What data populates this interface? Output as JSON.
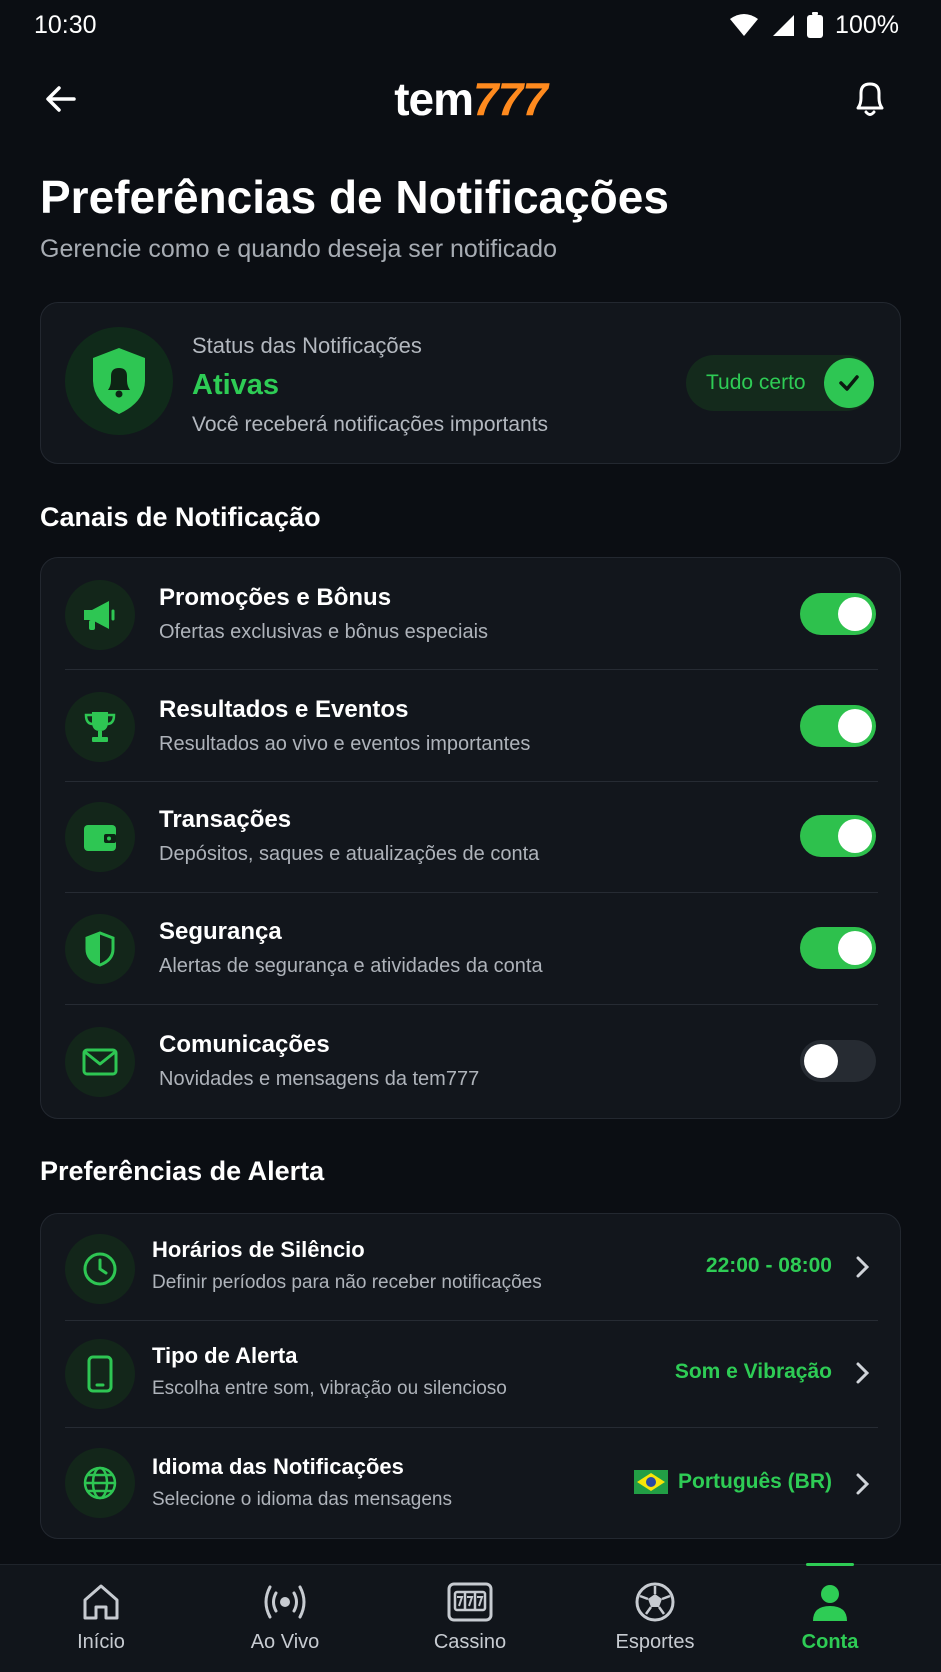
{
  "status_bar": {
    "time": "10:30",
    "battery": "100%"
  },
  "header": {
    "logo_part1": "tem",
    "logo_part2": "777"
  },
  "page": {
    "title": "Preferências de Notificações",
    "subtitle": "Gerencie como e quando deseja ser notificado"
  },
  "status_card": {
    "label": "Status das Notificações",
    "value": "Ativas",
    "description": "Você receberá notificações importants",
    "badge": "Tudo certo"
  },
  "channels": {
    "section_title": "Canais de Notificação",
    "items": [
      {
        "title": "Promoções e Bônus",
        "description": "Ofertas exclusivas e bônus especiais",
        "icon": "megaphone-icon",
        "enabled": true
      },
      {
        "title": "Resultados e Eventos",
        "description": "Resultados ao vivo e eventos importantes",
        "icon": "trophy-icon",
        "enabled": true
      },
      {
        "title": "Transações",
        "description": "Depósitos, saques e atualizações de conta",
        "icon": "wallet-icon",
        "enabled": true
      },
      {
        "title": "Segurança",
        "description": "Alertas de segurança e atividades da conta",
        "icon": "shield-icon",
        "enabled": true
      },
      {
        "title": "Comunicações",
        "description": "Novidades e mensagens da tem777",
        "icon": "mail-icon",
        "enabled": false
      }
    ]
  },
  "alerts": {
    "section_title": "Preferências de Alerta",
    "items": [
      {
        "title": "Horários de Silêncio",
        "description": "Definir períodos para não receber notificações",
        "value": "22:00 - 08:00",
        "icon": "clock-icon"
      },
      {
        "title": "Tipo de Alerta",
        "description": "Escolha entre som, vibração ou silencioso",
        "value": "Som e Vibração",
        "icon": "phone-icon"
      },
      {
        "title": "Idioma das Notificações",
        "description": "Selecione o idioma das mensagens",
        "value": "Português (BR)",
        "icon": "globe-icon"
      }
    ]
  },
  "nav": {
    "items": [
      {
        "label": "Início",
        "icon": "home-icon"
      },
      {
        "label": "Ao Vivo",
        "icon": "live-icon"
      },
      {
        "label": "Cassino",
        "icon": "slot-machine-icon"
      },
      {
        "label": "Esportes",
        "icon": "soccer-ball-icon"
      },
      {
        "label": "Conta",
        "icon": "user-icon",
        "active": true
      }
    ]
  },
  "colors": {
    "accent": "#2ecc55",
    "brand_orange": "#ff8a1e",
    "background": "#0b0e13",
    "card": "#12161c"
  }
}
